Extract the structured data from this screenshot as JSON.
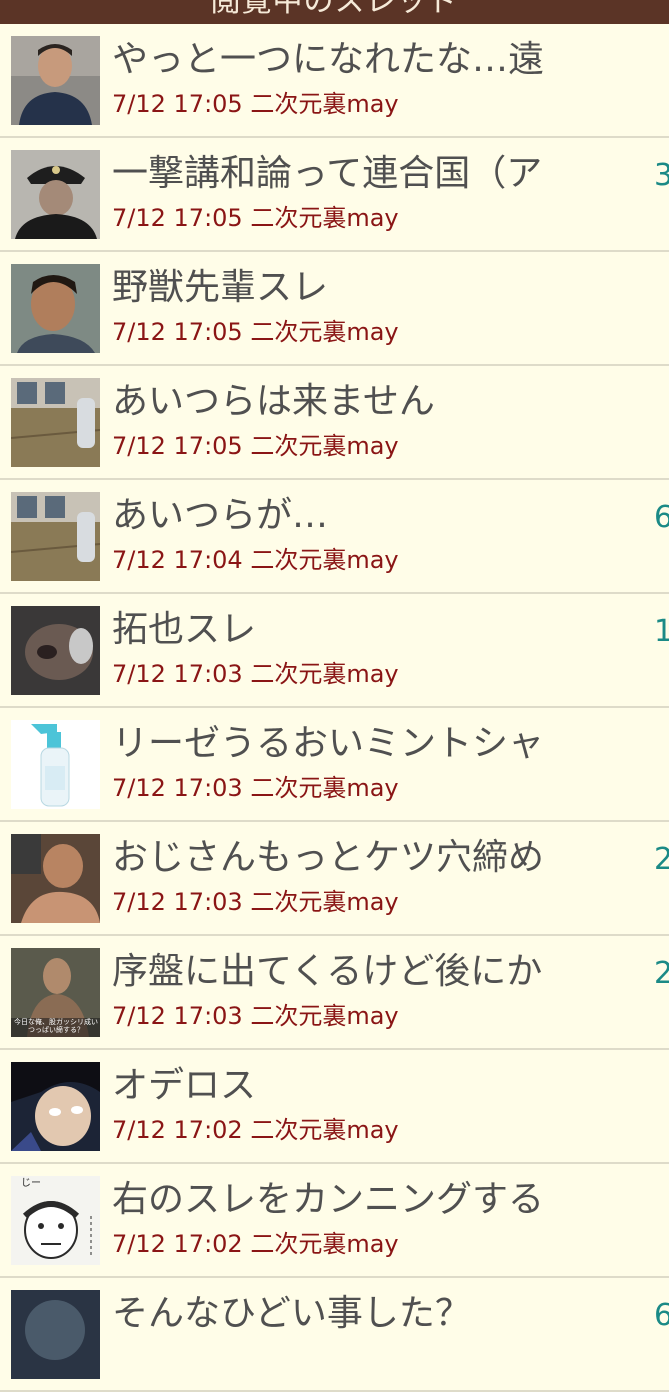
{
  "header": {
    "title": "閲覧中のスレッド"
  },
  "threads": [
    {
      "title": "やっと一つになれたな…遠",
      "date": "7/12 17:05",
      "board": "二次元裏may",
      "count": "",
      "thumb": "man-photo-icon"
    },
    {
      "title": "一撃講和論って連合国（ア",
      "date": "7/12 17:05",
      "board": "二次元裏may",
      "count": "3",
      "thumb": "naval-officer-photo-icon"
    },
    {
      "title": "野獣先輩スレ",
      "date": "7/12 17:05",
      "board": "二次元裏may",
      "count": "",
      "thumb": "man-face-photo-icon"
    },
    {
      "title": "あいつらは来ません",
      "date": "7/12 17:05",
      "board": "二次元裏may",
      "count": "",
      "thumb": "tatami-room-photo-icon"
    },
    {
      "title": "あいつらが…",
      "date": "7/12 17:04",
      "board": "二次元裏may",
      "count": "6",
      "thumb": "tatami-room-photo-icon"
    },
    {
      "title": "拓也スレ",
      "date": "7/12 17:03",
      "board": "二次元裏may",
      "count": "1",
      "thumb": "face-closeup-photo-icon"
    },
    {
      "title": "リーゼうるおいミントシャ",
      "date": "7/12 17:03",
      "board": "二次元裏may",
      "count": "",
      "thumb": "spray-bottle-icon"
    },
    {
      "title": "おじさんもっとケツ穴締め",
      "date": "7/12 17:03",
      "board": "二次元裏may",
      "count": "2",
      "thumb": "man-photo-icon"
    },
    {
      "title": "序盤に出てくるけど後にか",
      "date": "7/12 17:03",
      "board": "二次元裏may",
      "count": "2",
      "thumb": "man-caption-photo-icon"
    },
    {
      "title": "オデロス",
      "date": "7/12 17:02",
      "board": "二次元裏may",
      "count": "",
      "thumb": "anime-face-icon"
    },
    {
      "title": "右のスレをカンニングする",
      "date": "7/12 17:02",
      "board": "二次元裏may",
      "count": "",
      "thumb": "manga-face-icon"
    },
    {
      "title": "そんなひどい事した？",
      "date": "",
      "board": "",
      "count": "6",
      "thumb": "anime-face-icon"
    }
  ],
  "thumb_captions": {
    "row9": "今日な俺、股ガッシリ成い つっぱい締する？",
    "row11": "じー"
  }
}
